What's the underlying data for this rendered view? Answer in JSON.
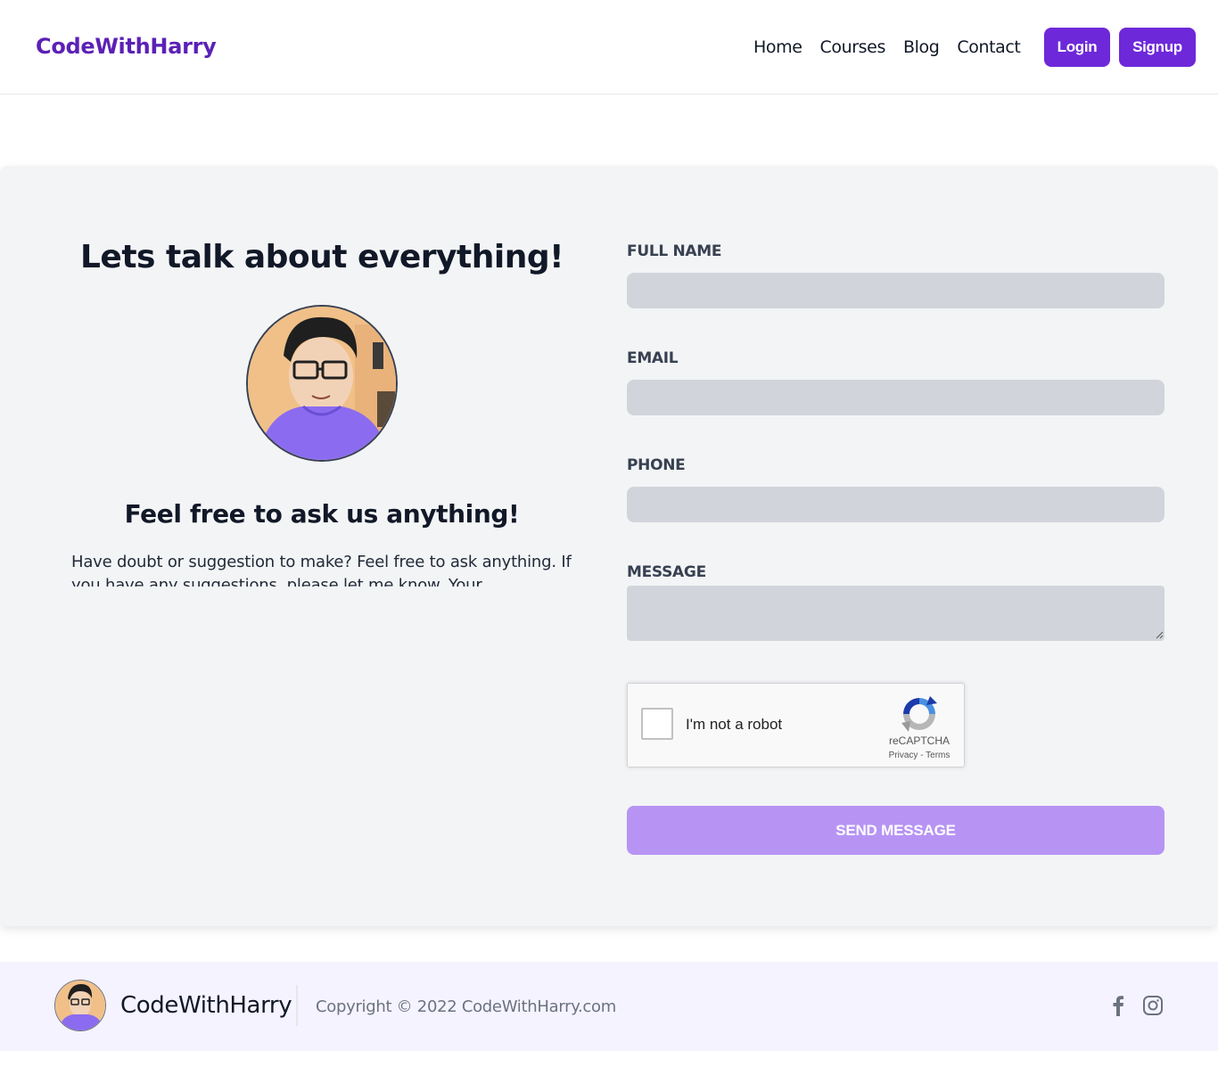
{
  "header": {
    "brand": "CodeWithHarry",
    "nav": [
      "Home",
      "Courses",
      "Blog",
      "Contact"
    ],
    "login_label": "Login",
    "signup_label": "Signup"
  },
  "intro": {
    "title": "Lets talk about everything!",
    "subtitle": "Feel free to ask us anything!",
    "paragraph": "Have doubt or suggestion to make? Feel free to ask anything. If you have any suggestions, please let me know. Your"
  },
  "form": {
    "full_name_label": "FULL NAME",
    "full_name_value": "",
    "email_label": "EMAIL",
    "email_value": "",
    "phone_label": "PHONE",
    "phone_value": "",
    "message_label": "MESSAGE",
    "message_value": "",
    "send_label": "SEND MESSAGE"
  },
  "captcha": {
    "label": "I'm not a robot",
    "brand": "reCAPTCHA",
    "privacy": "Privacy",
    "separator": " - ",
    "terms": "Terms",
    "checked": false
  },
  "footer": {
    "brand": "CodeWithHarry",
    "copyright": "Copyright © 2022 CodeWithHarry.com",
    "icons": [
      "facebook-icon",
      "instagram-icon"
    ]
  },
  "colors": {
    "brand_purple": "#5b21b6",
    "button_purple": "#6d28d9",
    "send_button": "#b794f4",
    "input_bg": "#d1d5db",
    "card_bg": "#f3f4f6",
    "footer_bg": "#f5f3ff"
  }
}
